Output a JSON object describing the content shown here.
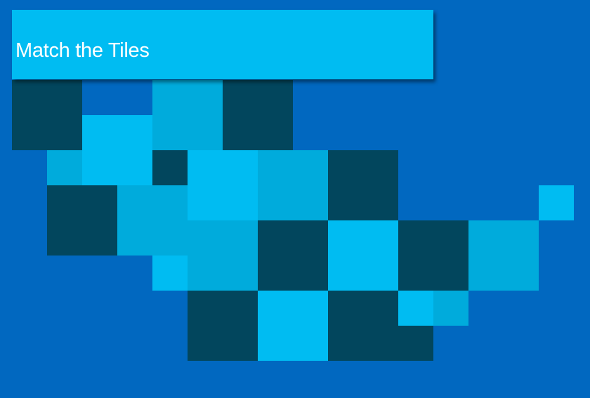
{
  "title": "Match the Tiles",
  "colors": {
    "background": "#0168c0",
    "banner": "#00bcf2",
    "bright": "#00bcf2",
    "medium": "#00abdc",
    "dark": "#02465d"
  },
  "board": {
    "tiles": [
      {
        "col": 0,
        "row": 0,
        "size": 2,
        "color": "dark"
      },
      {
        "col": 4,
        "row": 0,
        "size": 2,
        "color": "medium"
      },
      {
        "col": 6,
        "row": 0,
        "size": 2,
        "color": "dark"
      },
      {
        "col": 2,
        "row": 1,
        "size": 2,
        "color": "bright"
      },
      {
        "col": 1,
        "row": 2,
        "size": 1,
        "color": "medium"
      },
      {
        "col": 4,
        "row": 2,
        "size": 1,
        "color": "dark"
      },
      {
        "col": 5,
        "row": 2,
        "size": 2,
        "color": "bright"
      },
      {
        "col": 7,
        "row": 2,
        "size": 2,
        "color": "medium"
      },
      {
        "col": 9,
        "row": 2,
        "size": 2,
        "color": "dark"
      },
      {
        "col": 1,
        "row": 3,
        "size": 2,
        "color": "dark"
      },
      {
        "col": 3,
        "row": 3,
        "size": 2,
        "color": "medium"
      },
      {
        "col": 15,
        "row": 3,
        "size": 1,
        "color": "bright"
      },
      {
        "col": 5,
        "row": 4,
        "size": 2,
        "color": "medium"
      },
      {
        "col": 7,
        "row": 4,
        "size": 2,
        "color": "dark"
      },
      {
        "col": 9,
        "row": 4,
        "size": 2,
        "color": "bright"
      },
      {
        "col": 11,
        "row": 4,
        "size": 2,
        "color": "dark"
      },
      {
        "col": 13,
        "row": 4,
        "size": 2,
        "color": "medium"
      },
      {
        "col": 4,
        "row": 5,
        "size": 1,
        "color": "bright"
      },
      {
        "col": 5,
        "row": 6,
        "size": 2,
        "color": "dark"
      },
      {
        "col": 7,
        "row": 6,
        "size": 2,
        "color": "bright"
      },
      {
        "col": 9,
        "row": 6,
        "size": 2,
        "color": "dark"
      },
      {
        "col": 11,
        "row": 6,
        "size": 1,
        "color": "bright"
      },
      {
        "col": 12,
        "row": 6,
        "size": 1,
        "color": "medium"
      },
      {
        "col": 11,
        "row": 7,
        "size": 1,
        "color": "dark"
      }
    ]
  }
}
